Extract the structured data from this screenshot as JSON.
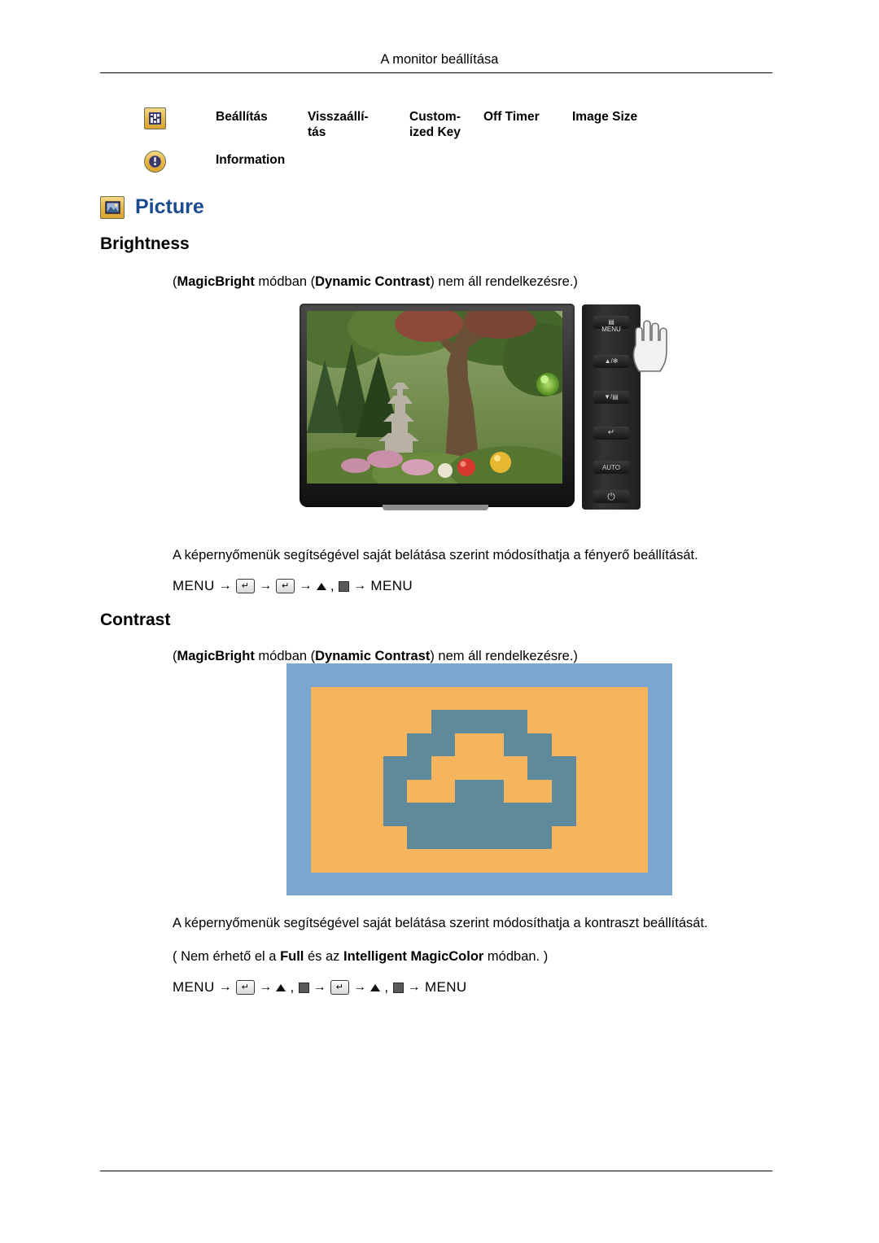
{
  "header": {
    "title": "A monitor beállítása"
  },
  "menubar": {
    "items": [
      {
        "label": "Beállítás",
        "icon": "settings-icon"
      },
      {
        "label": "Visszaállí-\ntás"
      },
      {
        "label": "Custom-\nized Key"
      },
      {
        "label": "Off Timer"
      },
      {
        "label": "Image Size"
      },
      {
        "label": "Information",
        "icon": "information-icon"
      }
    ]
  },
  "picture_section": {
    "title": "Picture",
    "icon": "picture-icon",
    "title_color": "#1b4b8f"
  },
  "brightness": {
    "heading": "Brightness",
    "note_prefix": "(",
    "note": "MagicBright módban (Dynamic Contrast) nem áll rendelkezésre.)",
    "note_bold_1": "MagicBright",
    "note_mid": " módban (",
    "note_bold_2": "Dynamic Contrast",
    "note_tail": ") nem áll rendelkezésre.)",
    "description": "A képernyőmenük segítségével saját belátása szerint módosíthatja a fényerő beállítását.",
    "menu_sequence": {
      "start": "MENU",
      "end": "MENU",
      "steps": [
        "enter",
        "enter",
        "up",
        "down"
      ]
    },
    "monitor_panel_labels": [
      "MENU",
      "▲/✻",
      "▼/▤",
      "↵",
      "AUTO",
      "⏻"
    ]
  },
  "contrast": {
    "heading": "Contrast",
    "note_bold_1": "MagicBright",
    "note_mid": " módban (",
    "note_bold_2": "Dynamic Contrast",
    "note_tail": ") nem áll rendelkezésre.)",
    "description": "A képernyőmenük segítségével saját belátása szerint módosíthatja a kontraszt beállítását.",
    "restriction_prefix": "( Nem érhető el a ",
    "restriction_bold_1": "Full",
    "restriction_mid": " és az ",
    "restriction_bold_2": "Intelligent MagicColor",
    "restriction_tail": " módban. )",
    "menu_sequence": {
      "start": "MENU",
      "end": "MENU",
      "steps": [
        "enter",
        "up",
        "down",
        "enter",
        "up",
        "down"
      ]
    },
    "figure": {
      "border_color": "#7ba7cf",
      "fill_color": "#f5b45e",
      "shape_color": "#5f8a9b"
    }
  }
}
